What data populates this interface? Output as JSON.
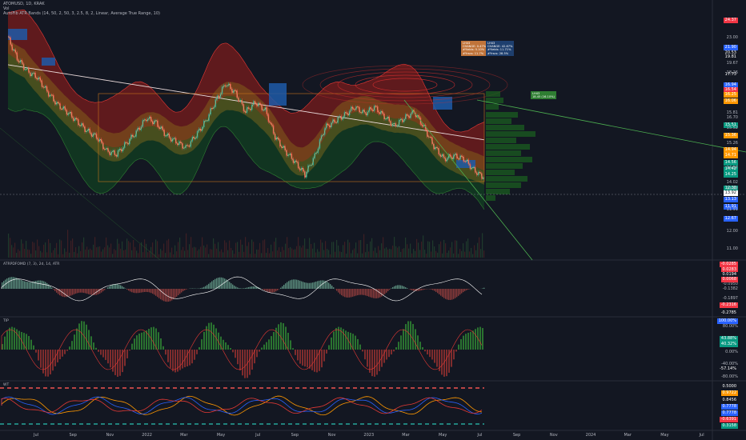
{
  "header": {
    "title": "ATOMUSD, 1D, KRAK",
    "line2": "Vol",
    "indicator_line": "AutoFib ATR Bands (14, 50, 2, 50, 3, 2.5, 8, 2, Linear, Average True Range, 10)"
  },
  "chart_data": {
    "type": "line",
    "title": "",
    "xlabel": "",
    "ylabel": "",
    "x_labels": [
      "Jul",
      "Sep",
      "Nov",
      "2022",
      "Mar",
      "May",
      "Jul",
      "Sep",
      "Nov",
      "2023",
      "Mar",
      "May",
      "Jul",
      "Sep",
      "Nov",
      "2024",
      "Mar",
      "May",
      "Jul"
    ],
    "price_axis_ticks": [
      "23.00",
      "19.67",
      "18.26",
      "16.70",
      "15.81",
      "15.52",
      "15.26",
      "14.57",
      "14.02",
      "13.82",
      "11.91",
      "12.00",
      "11.00"
    ],
    "price_badges": [
      {
        "text": "24.37",
        "color": "#f23645"
      },
      {
        "text": "21.90",
        "color": "#2962ff"
      },
      {
        "text": "20.53",
        "color": "#131722"
      },
      {
        "text": "19.81",
        "color": "#131722"
      },
      {
        "text": "17.73",
        "color": "#131722"
      },
      {
        "text": "16.94",
        "color": "#2962ff"
      },
      {
        "text": "16.54",
        "color": "#f23645"
      },
      {
        "text": "16.25",
        "color": "#ff9800"
      },
      {
        "text": "16.06",
        "color": "#ff9800"
      },
      {
        "text": "15.51",
        "color": "#089981"
      },
      {
        "text": "15.36",
        "color": "#ff9800"
      },
      {
        "text": "14.94",
        "color": "#ff9800"
      },
      {
        "text": "14.71",
        "color": "#ff9800"
      },
      {
        "text": "14.56",
        "color": "#089981"
      },
      {
        "text": "14.42",
        "color": "#089981"
      },
      {
        "text": "14.25",
        "color": "#089981"
      },
      {
        "text": "12.38",
        "color": "#089981"
      },
      {
        "text": "13.92",
        "color": "#ffffff"
      },
      {
        "text": "13.13",
        "color": "#2962ff"
      },
      {
        "text": "11.91",
        "color": "#2962ff"
      },
      {
        "text": "12.67",
        "color": "#2962ff"
      }
    ],
    "series": [
      {
        "values": [
          22.4,
          21.0,
          20.2,
          19.8,
          18.9,
          18.1,
          17.6,
          17.0,
          16.4,
          16.0,
          15.1,
          14.9,
          15.6,
          16.3,
          17.2,
          16.9,
          16.1,
          15.7,
          15.3,
          16.1,
          17.0,
          18.3,
          19.4,
          18.8,
          17.6,
          18.2,
          17.7,
          16.0,
          15.1,
          14.4,
          13.6,
          14.8,
          16.6,
          17.0,
          17.4,
          17.9,
          17.5,
          17.9,
          17.3,
          16.7,
          17.2,
          17.6,
          16.6,
          15.4,
          14.6,
          14.8,
          14.6,
          13.9,
          13.4
        ]
      }
    ],
    "sub_panes": [
      {
        "name": "ATRPDFOMD (7, 3), 2d, 14, ATR",
        "ticks": [
          "-0.0950",
          "-0.1382",
          "-0.1897",
          "-0.2316",
          "-0.2785"
        ],
        "badges": [
          {
            "text": "-0.0285",
            "color": "#f23645"
          },
          {
            "text": "0.0283",
            "color": "#f23645"
          },
          {
            "text": "0.0194",
            "color": "#131722"
          },
          {
            "text": "0.0068",
            "color": "#f23645"
          },
          {
            "text": "-0.2316",
            "color": "#f23645"
          },
          {
            "text": "-0.2785",
            "color": "#131722"
          }
        ]
      },
      {
        "name": "TIP",
        "ticks": [
          "80.00%",
          "0.00%",
          "-40.00%",
          "-80.00%"
        ],
        "badges": [
          {
            "text": "100.00%",
            "color": "#2962ff"
          },
          {
            "text": "43.88%",
            "color": "#089981"
          },
          {
            "text": "40.32%",
            "color": "#089981"
          },
          {
            "text": "-57.14%",
            "color": "#131722"
          }
        ]
      },
      {
        "name": "WT",
        "badges": [
          {
            "text": "0.5000",
            "color": "#131722"
          },
          {
            "text": "0.9722",
            "color": "#ff9800"
          },
          {
            "text": "0.8456",
            "color": "#131722"
          },
          {
            "text": "0.7778",
            "color": "#2962ff"
          },
          {
            "text": "0.7778",
            "color": "#2962ff"
          },
          {
            "text": "-0.6391",
            "color": "#f23645"
          },
          {
            "text": "0.3158",
            "color": "#089981"
          }
        ]
      }
    ]
  },
  "tooltips": [
    {
      "title": "LH43",
      "lines": [
        "CHANGE: 0.47%",
        "#Yields: 5.10%",
        "#Yrscs: 11.7%"
      ],
      "color": "#c0743a"
    },
    {
      "title": "LH43",
      "lines": [
        "CHANGE: 42.67%",
        "#Yields: 11.71%",
        "#Yrscs: 28.5%"
      ],
      "color": "#1e3f6e"
    },
    {
      "title": "LH43",
      "lines": [
        "18.45 (16.10%)"
      ],
      "color": "#2e7d32"
    }
  ]
}
